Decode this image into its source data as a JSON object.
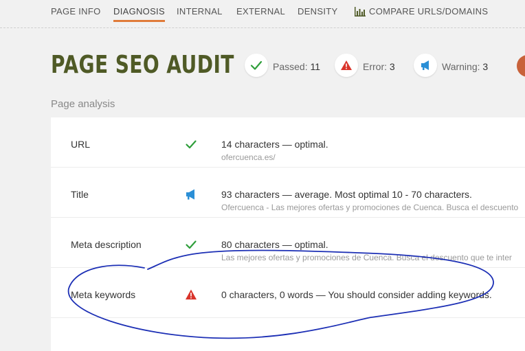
{
  "nav": {
    "items": [
      {
        "label": "PAGE INFO"
      },
      {
        "label": "DIAGNOSIS",
        "active": true
      },
      {
        "label": "INTERNAL"
      },
      {
        "label": "EXTERNAL"
      },
      {
        "label": "DENSITY"
      },
      {
        "label": "COMPARE URLS/DOMAINS",
        "icon": "bar-chart-icon"
      }
    ]
  },
  "header": {
    "title": "PAGE SEO AUDIT"
  },
  "stats": {
    "passed": {
      "label": "Passed:",
      "value": "11",
      "icon": "checkmark-icon",
      "color": "#2e9e3a"
    },
    "error": {
      "label": "Error:",
      "value": "3",
      "icon": "warning-triangle-icon",
      "color": "#d9342b"
    },
    "warning": {
      "label": "Warning:",
      "value": "3",
      "icon": "megaphone-icon",
      "color": "#2b8fd6"
    }
  },
  "section": {
    "title": "Page analysis"
  },
  "rows": [
    {
      "label": "URL",
      "status": "checkmark-icon",
      "main": "14 characters — optimal.",
      "sub": "ofercuenca.es/"
    },
    {
      "label": "Title",
      "status": "megaphone-icon",
      "main": "93 characters — average. Most optimal 10 - 70 characters.",
      "sub": "Ofercuenca - Las mejores ofertas y promociones de Cuenca. Busca el descuento"
    },
    {
      "label": "Meta description",
      "status": "checkmark-icon",
      "main": "80 characters — optimal.",
      "sub": "Las mejores ofertas y promociones de Cuenca. Busca el descuento que te inter"
    },
    {
      "label": "Meta keywords",
      "status": "warning-triangle-icon",
      "main": "0 characters, 0 words — You should consider adding keywords.",
      "sub": ""
    }
  ],
  "colors": {
    "accent": "#e07b39",
    "title": "#4f5a26",
    "annotation": "#1c2fb5"
  }
}
